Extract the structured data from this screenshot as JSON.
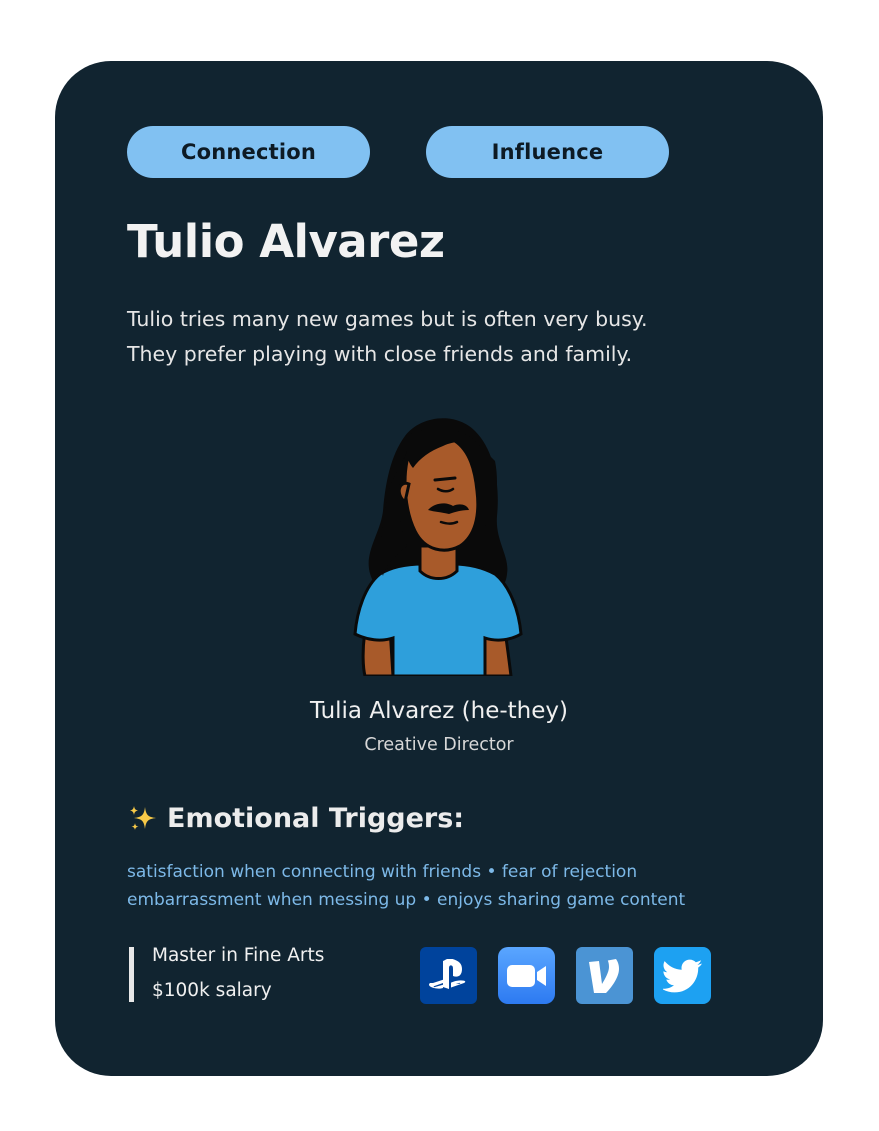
{
  "tags": [
    "Connection",
    "Influence"
  ],
  "persona": {
    "title": "Tulio Alvarez",
    "description_lines": [
      "Tulio tries many new games but is often very busy.",
      "They prefer playing with close friends and family."
    ],
    "name": "Tulia Alvarez (he-they)",
    "role": "Creative Director"
  },
  "triggers": {
    "heading": "Emotional Triggers:",
    "lines": [
      "satisfaction when connecting with friends • fear of rejection",
      "embarrassment when messing up • enjoys sharing game content"
    ]
  },
  "facts": [
    "Master in Fine Arts",
    "$100k salary"
  ],
  "apps": [
    {
      "name": "playstation-icon",
      "color": "#00439c"
    },
    {
      "name": "zoom-icon",
      "color": "#2d8cff"
    },
    {
      "name": "venmo-icon",
      "color": "#4b94d4"
    },
    {
      "name": "twitter-icon",
      "color": "#1da1f2"
    }
  ],
  "colors": {
    "card_bg": "#112430",
    "tag_bg": "#81c1f2",
    "trigger_text": "#7db9e8"
  }
}
